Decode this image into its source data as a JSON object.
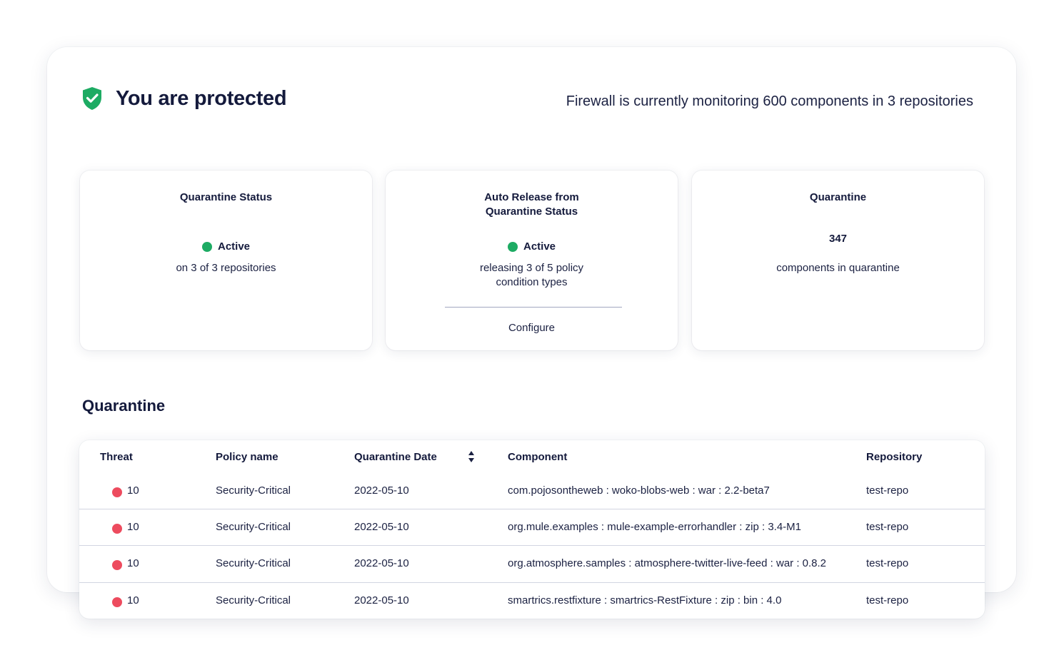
{
  "header": {
    "title": "You are protected",
    "monitoring_text": "Firewall is currently monitoring 600 components in 3 repositories"
  },
  "cards": [
    {
      "title": "Quarantine Status",
      "status": "Active",
      "subtitle": "on 3 of 3 repositories"
    },
    {
      "title_line1": "Auto Release from",
      "title_line2": "Quarantine Status",
      "status": "Active",
      "subtitle_line1": "releasing 3 of 5 policy",
      "subtitle_line2": "condition types",
      "link": "Configure"
    },
    {
      "title": "Quarantine",
      "count": "347",
      "subtitle": "components in quarantine"
    }
  ],
  "quarantine_section": {
    "title": "Quarantine",
    "columns": {
      "threat": "Threat",
      "policy": "Policy name",
      "date": "Quarantine Date",
      "component": "Component",
      "repository": "Repository"
    },
    "rows": [
      {
        "threat": "10",
        "policy": "Security-Critical",
        "date": "2022-05-10",
        "component": "com.pojosontheweb : woko-blobs-web : war : 2.2-beta7",
        "repository": "test-repo"
      },
      {
        "threat": "10",
        "policy": "Security-Critical",
        "date": "2022-05-10",
        "component": "org.mule.examples : mule-example-errorhandler : zip : 3.4-M1",
        "repository": "test-repo"
      },
      {
        "threat": "10",
        "policy": "Security-Critical",
        "date": "2022-05-10",
        "component": "org.atmosphere.samples : atmosphere-twitter-live-feed : war : 0.8.2",
        "repository": "test-repo"
      },
      {
        "threat": "10",
        "policy": "Security-Critical",
        "date": "2022-05-10",
        "component": "smartrics.restfixture : smartrics-RestFixture : zip : bin : 4.0",
        "repository": "test-repo"
      }
    ]
  },
  "colors": {
    "active": "#1dab63",
    "threat": "#ed4b5e",
    "shield": "#1dab63",
    "text": "#141a3c"
  },
  "icons": {
    "header": "shield-check-icon",
    "status": "status-dot-icon",
    "sort": "sort-icon",
    "threat": "threat-dot-icon"
  }
}
